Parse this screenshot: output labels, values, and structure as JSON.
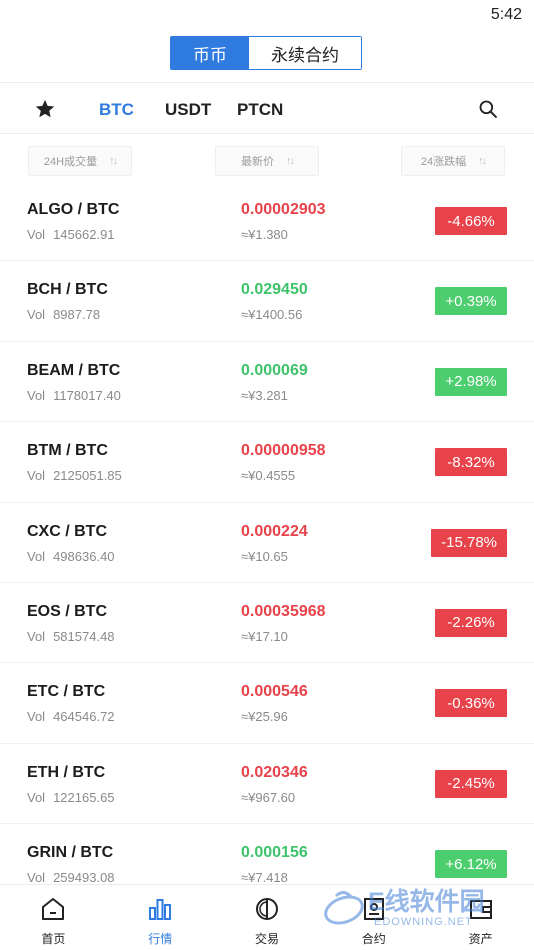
{
  "status": {
    "time": "5:42"
  },
  "mode_toggle": {
    "spot": "币币",
    "contract": "永续合约"
  },
  "market_tabs": {
    "favorites_icon": "star-icon",
    "tabs": [
      "BTC",
      "USDT",
      "PTCN"
    ],
    "active": "BTC",
    "search_icon": "search-icon"
  },
  "sort": {
    "volume": "24H成交量",
    "price": "最新价",
    "change": "24涨跌幅"
  },
  "rows": [
    {
      "pair": "ALGO / BTC",
      "vol": "145662.91",
      "price": "0.00002903",
      "cny": "≈¥1.380",
      "change": "-4.66%",
      "dir": "down"
    },
    {
      "pair": "BCH / BTC",
      "vol": "8987.78",
      "price": "0.029450",
      "cny": "≈¥1400.56",
      "change": "+0.39%",
      "dir": "up"
    },
    {
      "pair": "BEAM / BTC",
      "vol": "1178017.40",
      "price": "0.000069",
      "cny": "≈¥3.281",
      "change": "+2.98%",
      "dir": "up"
    },
    {
      "pair": "BTM / BTC",
      "vol": "2125051.85",
      "price": "0.00000958",
      "cny": "≈¥0.4555",
      "change": "-8.32%",
      "dir": "down"
    },
    {
      "pair": "CXC / BTC",
      "vol": "498636.40",
      "price": "0.000224",
      "cny": "≈¥10.65",
      "change": "-15.78%",
      "dir": "down"
    },
    {
      "pair": "EOS / BTC",
      "vol": "581574.48",
      "price": "0.00035968",
      "cny": "≈¥17.10",
      "change": "-2.26%",
      "dir": "down"
    },
    {
      "pair": "ETC / BTC",
      "vol": "464546.72",
      "price": "0.000546",
      "cny": "≈¥25.96",
      "change": "-0.36%",
      "dir": "down"
    },
    {
      "pair": "ETH / BTC",
      "vol": "122165.65",
      "price": "0.020346",
      "cny": "≈¥967.60",
      "change": "-2.45%",
      "dir": "down"
    },
    {
      "pair": "GRIN / BTC",
      "vol": "259493.08",
      "price": "0.000156",
      "cny": "≈¥7.418",
      "change": "+6.12%",
      "dir": "up"
    }
  ],
  "vol_label": "Vol",
  "nav": [
    {
      "label": "首页",
      "icon": "home-icon"
    },
    {
      "label": "行情",
      "icon": "market-chart-icon",
      "active": true
    },
    {
      "label": "交易",
      "icon": "trade-icon"
    },
    {
      "label": "合约",
      "icon": "contract-icon"
    },
    {
      "label": "资产",
      "icon": "wallet-icon"
    }
  ],
  "watermark": {
    "title": "E线软件园",
    "sub": "EDOWNING.NET"
  },
  "colors": {
    "accent": "#2f7be0",
    "down": "#e8424a",
    "up": "#4ccd6e",
    "up_text": "#3ec36b"
  }
}
